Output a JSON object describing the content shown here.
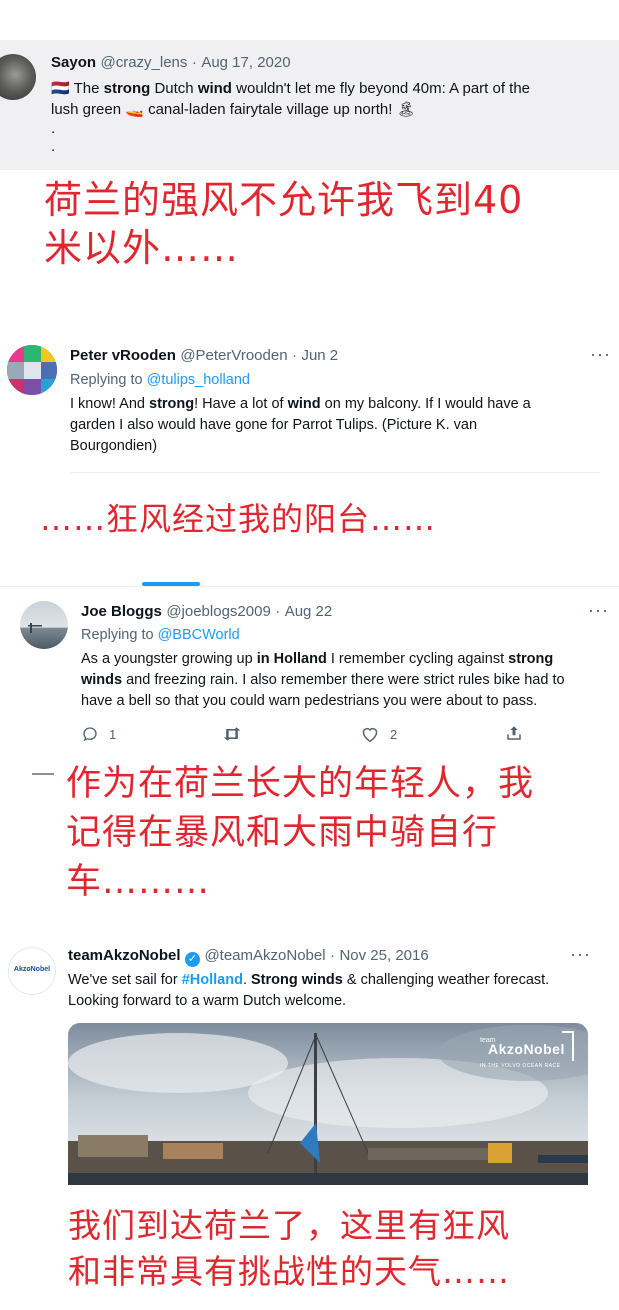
{
  "tweet1": {
    "name": "Sayon",
    "handle": "@crazy_lens",
    "sep": "·",
    "date": "Aug 17, 2020",
    "flag_emoji": "🇳🇱",
    "text_p1": " The ",
    "text_strong": "strong",
    "text_p2": " Dutch ",
    "text_wind": "wind",
    "text_p3": " wouldn't let me fly beyond 40m: A part of the",
    "text_line2_a": "lush green ",
    "boat_emoji": "🚤",
    "text_line2_b": " canal-laden fairytale village up north! ",
    "island_emoji": "🏝",
    "dot1": ".",
    "dot2": "."
  },
  "caption1": [
    "荷兰的强风不允许我飞到40",
    "米以外……"
  ],
  "tweet2": {
    "name": "Peter vRooden",
    "handle": "@PeterVrooden",
    "sep": "·",
    "date": "Jun 2",
    "more": "···",
    "replying_label": "Replying to ",
    "replying_to": "@tulips_holland",
    "t1": "I know! And ",
    "t_strong": "strong",
    "t2": "! Have a lot of ",
    "t_wind": "wind",
    "t3": " on my balcony. If I would have a",
    "line2": "garden I also would have gone for Parrot Tulips. (Picture K. van",
    "line3": "Bourgondien)"
  },
  "caption2": "……狂风经过我的阳台……",
  "tweet3": {
    "name": "Joe Bloggs",
    "handle": "@joeblogs2009",
    "sep": "·",
    "date": "Aug 22",
    "more": "···",
    "replying_label": "Replying to ",
    "replying_to": "@BBCWorld",
    "l1a": "As a youngster growing up ",
    "l1b": "in Holland",
    "l1c": "  I remember cycling against ",
    "l1d": "strong",
    "l2a": "winds",
    "l2b": " and freezing rain. I also remember there were strict rules bike had to",
    "l3": "have a bell so that you could warn pedestrians you were about to pass.",
    "replies": "1",
    "likes": "2"
  },
  "caption3": [
    "作为在荷兰长大的年轻人，我",
    "记得在暴风和大雨中骑自行",
    "车………"
  ],
  "tweet4": {
    "name": "teamAkzoNobel",
    "handle": "@teamAkzoNobel",
    "sep": "·",
    "date": "Nov 25, 2016",
    "more": "···",
    "avatar_text": "AkzoNobel",
    "l1a": "We've set sail for ",
    "l1b": "#Holland",
    "l1c": ". ",
    "l1d": "Strong winds",
    "l1e": " & challenging weather forecast.",
    "l2": "Looking forward to a warm Dutch welcome.",
    "img_brand_small": "team",
    "img_brand": "AkzoNobel",
    "img_brand_sub": "IN THE VOLVO OCEAN RACE"
  },
  "caption4": [
    "我们到达荷兰了，这里有狂风",
    "和非常具有挑战性的天气……"
  ],
  "colors": {
    "accent": "#1d9bf0",
    "caption_red": "#e0262e",
    "verified": "#1d9bf0"
  }
}
